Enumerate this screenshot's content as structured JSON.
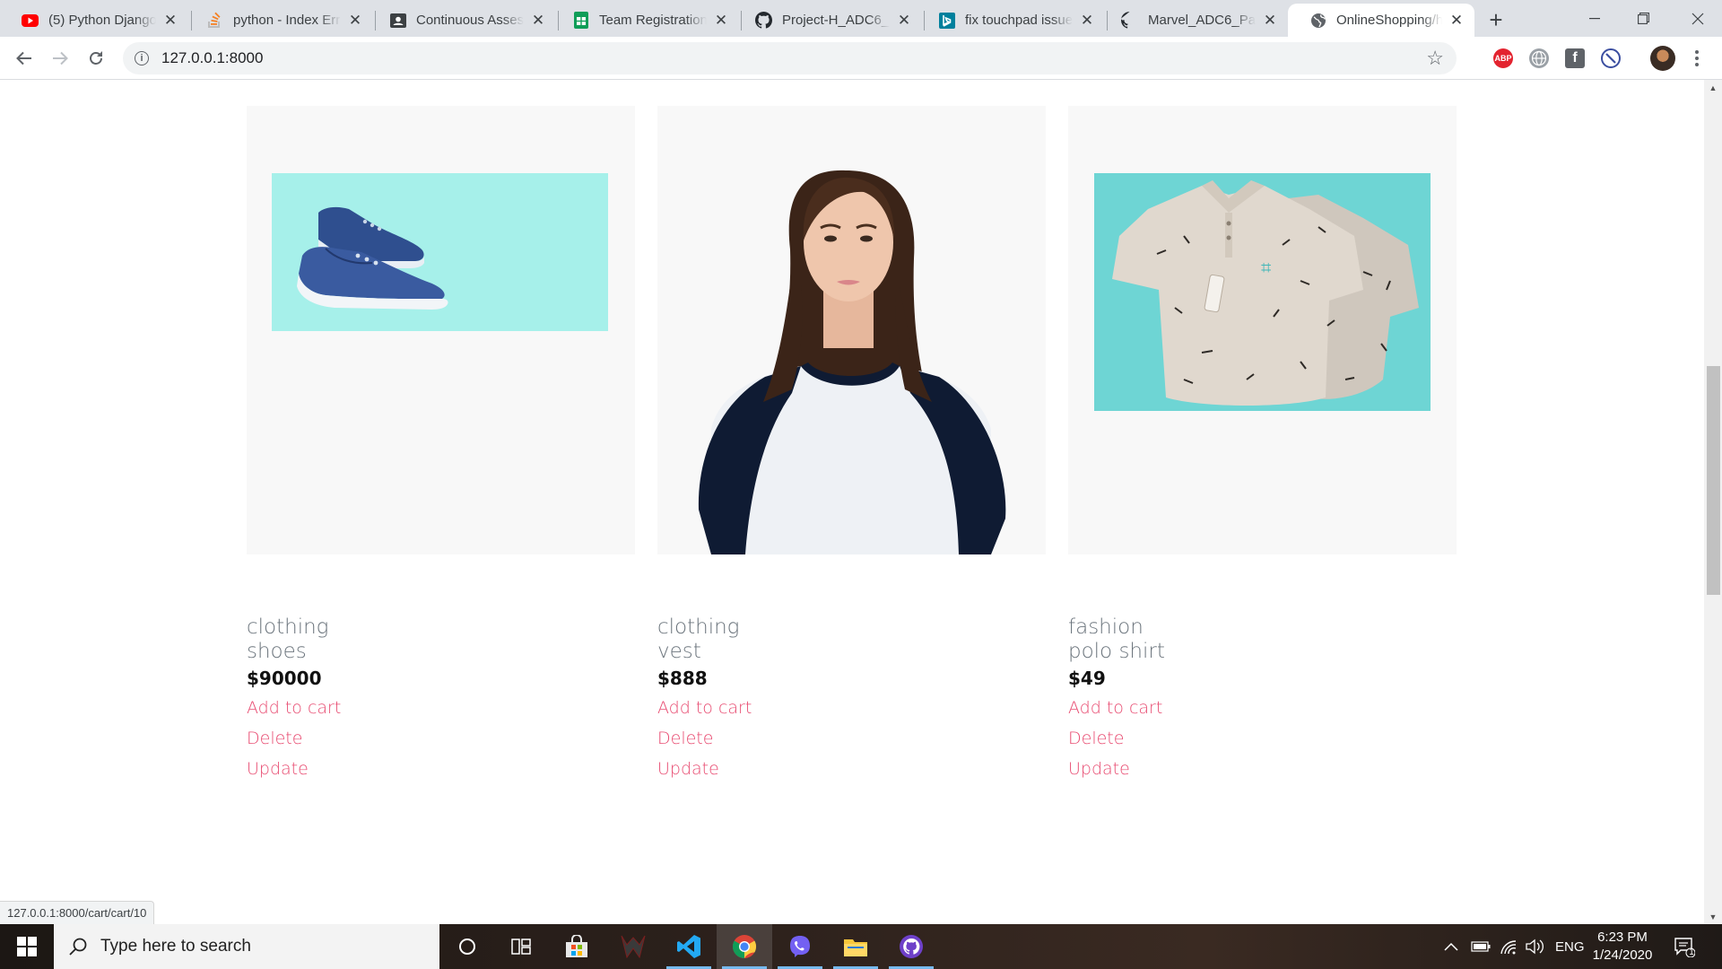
{
  "browser": {
    "tabs": [
      {
        "label": "(5) Python Django",
        "icon": "youtube-icon"
      },
      {
        "label": "python - Index Err",
        "icon": "stackoverflow-icon"
      },
      {
        "label": "Continuous Assess",
        "icon": "classroom-icon"
      },
      {
        "label": "Team Registration",
        "icon": "sheets-icon"
      },
      {
        "label": "Project-H_ADC6_P",
        "icon": "github-icon"
      },
      {
        "label": "fix touchpad issue",
        "icon": "bing-icon"
      },
      {
        "label": "Marvel_ADC6_Part",
        "icon": "github-icon"
      },
      {
        "label": "OnlineShopping/h",
        "icon": "globe-icon",
        "active": true
      }
    ],
    "new_tab": "+",
    "url": "127.0.0.1:8000",
    "extensions": [
      {
        "name": "adblock-icon",
        "text": "ABP",
        "color": "#e3232f"
      },
      {
        "name": "globe-extension-icon",
        "text": "",
        "color": "#9aa0a6"
      },
      {
        "name": "facebook-icon",
        "text": "f",
        "color": "#5f6368"
      },
      {
        "name": "block-icon",
        "text": "",
        "color": "#3b4ea0"
      }
    ],
    "status_url": "127.0.0.1:8000/cart/cart/10"
  },
  "products": [
    {
      "category": "clothing",
      "name": "shoes",
      "price": "$90000",
      "image": "blue-sneakers-image",
      "actions": {
        "add": "Add to cart",
        "delete": "Delete",
        "update": "Update"
      }
    },
    {
      "category": "clothing",
      "name": "vest",
      "price": "$888",
      "image": "woman-raglan-tshirt-image",
      "actions": {
        "add": "Add to cart",
        "delete": "Delete",
        "update": "Update"
      }
    },
    {
      "category": "fashion",
      "name": "polo shirt",
      "price": "$49",
      "image": "printed-polo-shirt-image",
      "actions": {
        "add": "Add to cart",
        "delete": "Delete",
        "update": "Update"
      }
    }
  ],
  "colors": {
    "link": "#e84a70",
    "muted_text": "#6c757d",
    "card_bg": "#f8f8f8",
    "shoe_bg": "#a6f0ea",
    "polo_bg": "#6ed5d4"
  },
  "taskbar": {
    "search_placeholder": "Type here to search",
    "language": "ENG",
    "time": "6:23 PM",
    "date": "1/24/2020",
    "notification_count": "1"
  }
}
